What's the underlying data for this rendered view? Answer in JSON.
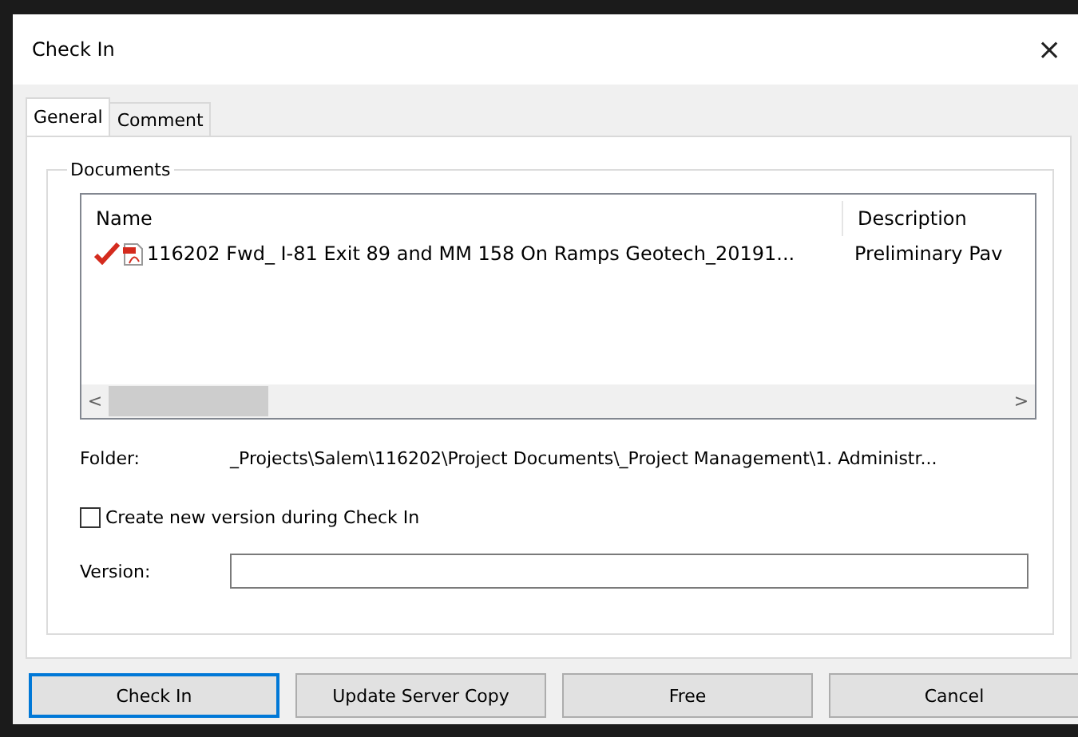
{
  "window": {
    "title": "Check In",
    "close": "×"
  },
  "tabs": [
    {
      "label": "General",
      "selected": true
    },
    {
      "label": "Comment",
      "selected": false
    }
  ],
  "documents": {
    "title": "Documents",
    "columns": [
      "Name",
      "Description"
    ],
    "rows": [
      {
        "checked": true,
        "name": "116202 Fwd_ I-81 Exit 89 and MM 158 On Ramps Geotech_20191...",
        "description": "Preliminary Pav"
      }
    ],
    "scroll_left": "<",
    "scroll_right": ">"
  },
  "folder": {
    "label": "Folder:",
    "value": "_Projects\\Salem\\116202\\Project Documents\\_Project Management\\1.  Administr..."
  },
  "new_version": {
    "label": "Create new version during Check In",
    "checked": false
  },
  "version": {
    "label": "Version:"
  },
  "buttons": [
    {
      "label": "Check In",
      "default": true
    },
    {
      "label": "Update Server Copy",
      "default": false
    },
    {
      "label": "Free",
      "default": false
    },
    {
      "label": "Cancel",
      "default": false
    }
  ]
}
